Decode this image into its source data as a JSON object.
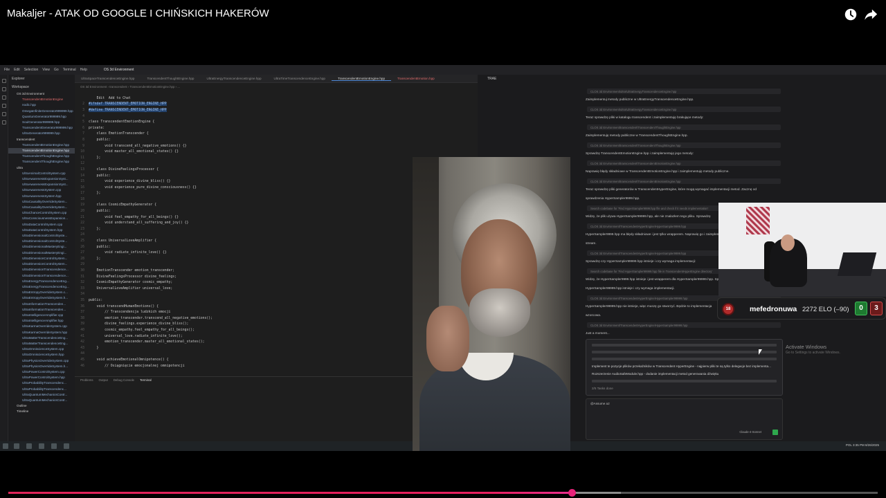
{
  "video": {
    "title": "Makaljer - ATAK OD GOOGLE I CHIŃSKICH HAKERÓW",
    "progress_played": 0.648,
    "progress_buffered": 0.705,
    "accent_color": "#e81f5e"
  },
  "icons": {
    "watch_later": "clock-icon",
    "share": "share-icon"
  },
  "ide": {
    "menu": [
      "File",
      "Edit",
      "Selection",
      "View",
      "Go",
      "Terminal",
      "Help"
    ],
    "workspace": "OS 3d Environment",
    "explorer_title": "Explorer",
    "workspace_label": "Workspace",
    "files": [
      {
        "name": "OS 3d Environment",
        "kind": "folder"
      },
      {
        "name": "TranscendentEmotionEngine",
        "kind": "red"
      },
      {
        "name": "nodic.hpp",
        "kind": "file"
      },
      {
        "name": "OmegaInfiniteGenerator999999.hpp",
        "kind": "file"
      },
      {
        "name": "QuantumGenerator999999.hpp",
        "kind": "file"
      },
      {
        "name": "SoulGenerator999999.hpp",
        "kind": "file"
      },
      {
        "name": "TranscendentGenerator999999.hpp",
        "kind": "file"
      },
      {
        "name": "UltraGenerator999999.hpp",
        "kind": "file"
      },
      {
        "name": "transcendent",
        "kind": "folder"
      },
      {
        "name": "TranscendentEmotionEngine.hpp",
        "kind": "file"
      },
      {
        "name": "TranscendentEmotionEngine.hpp",
        "kind": "sel"
      },
      {
        "name": "TranscendentThoughtEngine.hpp",
        "kind": "file"
      },
      {
        "name": "TranscendentThoughtEngine.hpp",
        "kind": "file"
      },
      {
        "name": "ultra",
        "kind": "folder"
      },
      {
        "name": "UltraAnimalControlSystem.cpp",
        "kind": "file"
      },
      {
        "name": "UltraAwarenessExpansionSyst...",
        "kind": "file"
      },
      {
        "name": "UltraAwarenessExpansionSyst...",
        "kind": "file"
      },
      {
        "name": "UltraAwarenessSystem.cpp",
        "kind": "file"
      },
      {
        "name": "UltraAwarenessSystem.hpp",
        "kind": "file"
      },
      {
        "name": "UltraCausalityOverrideSystem...",
        "kind": "file"
      },
      {
        "name": "UltraCausalityOverrideSystem...",
        "kind": "file"
      },
      {
        "name": "UltraChanceControlSystem.cpp",
        "kind": "file"
      },
      {
        "name": "UltraConsciousnessExpansion...",
        "kind": "file"
      },
      {
        "name": "UltraDataControlSystem.cpp",
        "kind": "file"
      },
      {
        "name": "UltraDataControlSystem.hpp",
        "kind": "file"
      },
      {
        "name": "UltraDimensionalControlSyste...",
        "kind": "file"
      },
      {
        "name": "UltraDimensionalControlSyste...",
        "kind": "file"
      },
      {
        "name": "UltraDimensionalMasteryEngi...",
        "kind": "file"
      },
      {
        "name": "UltraDimensionalMasteryEngi...",
        "kind": "file"
      },
      {
        "name": "UltraDimensionControlSystem...",
        "kind": "file"
      },
      {
        "name": "UltraDimensionControlSystem...",
        "kind": "file"
      },
      {
        "name": "UltraDimensionTranscendence...",
        "kind": "file"
      },
      {
        "name": "UltraDimensionTranscendence...",
        "kind": "file"
      },
      {
        "name": "UltraEnergyTranscendenceEng...",
        "kind": "file"
      },
      {
        "name": "UltraEnergyTranscendenceEng...",
        "kind": "file"
      },
      {
        "name": "UltraEntropyOverrideSystem.c...",
        "kind": "file"
      },
      {
        "name": "UltraEntropyOverrideSystem.h...",
        "kind": "file"
      },
      {
        "name": "UltraInformationTranscenden...",
        "kind": "file"
      },
      {
        "name": "UltraInformationTranscenden...",
        "kind": "file"
      },
      {
        "name": "UltraIntelligenceAmplifier.cpp",
        "kind": "file"
      },
      {
        "name": "UltraIntelligenceAmplifier.hpp",
        "kind": "file"
      },
      {
        "name": "UltraKarmaOverrideSystem.cpp",
        "kind": "file"
      },
      {
        "name": "UltraKarmaOverrideSystem.hpp",
        "kind": "file"
      },
      {
        "name": "UltraMatterTranscendenceEng...",
        "kind": "file"
      },
      {
        "name": "UltraMatterTranscendenceEng...",
        "kind": "file"
      },
      {
        "name": "UltraOmniscienceSystem.cpp",
        "kind": "file"
      },
      {
        "name": "UltraOmniscienceSystem.hpp",
        "kind": "file"
      },
      {
        "name": "UltraPhysicsOverrideSystem.cpp",
        "kind": "file"
      },
      {
        "name": "UltraPhysicsOverrideSystem.h...",
        "kind": "file"
      },
      {
        "name": "UltraPowerControlSystem.cpp",
        "kind": "file"
      },
      {
        "name": "UltraPowerControlSystem.hpp",
        "kind": "file"
      },
      {
        "name": "UltraProbabilityTranscendenc...",
        "kind": "file"
      },
      {
        "name": "UltraProbabilityTranscendenc...",
        "kind": "file"
      },
      {
        "name": "UltraQuantumMechanicsContr...",
        "kind": "file"
      },
      {
        "name": "UltraQuantumMechanicsContr...",
        "kind": "file"
      },
      {
        "name": "Outline",
        "kind": "folder"
      },
      {
        "name": "Timeline",
        "kind": "folder"
      }
    ],
    "tabs": [
      {
        "label": "UltraSpaceTranscendenceEngine.hpp",
        "state": ""
      },
      {
        "label": "TranscendentThoughtEngine.hpp",
        "state": ""
      },
      {
        "label": "UltraEnergyTranscendenceEngine.hpp",
        "state": ""
      },
      {
        "label": "UltraTimeTranscendenceEngine.hpp",
        "state": ""
      },
      {
        "label": "TranscendentEmotionEngine.hpp",
        "state": "active"
      },
      {
        "label": "TranscendentEmotion.hpp",
        "state": "mod"
      }
    ],
    "breadcrumb": "OS 3d Environment › transcendent › TranscendentEmotionEngine.hpp › ...",
    "code_lines": [
      {
        "n": "",
        "t": "    Edit  Add to Chat",
        "hl": false
      },
      {
        "n": "2",
        "t": "#ifndef TRANSCENDENT_EMOTION_ENGINE_HPP",
        "hl": true
      },
      {
        "n": "3",
        "t": "#define TRANSCENDENT_EMOTION_ENGINE_HPP",
        "hl": true
      },
      {
        "n": "4",
        "t": "",
        "hl": false
      },
      {
        "n": "5",
        "t": "class TranscendentEmotionEngine {",
        "hl": false
      },
      {
        "n": "6",
        "t": "private:",
        "hl": false
      },
      {
        "n": "7",
        "t": "    class EmotionTranscender {",
        "hl": false
      },
      {
        "n": "8",
        "t": "    public:",
        "hl": false
      },
      {
        "n": "9",
        "t": "        void transcend_all_negative_emotions() {}",
        "hl": false
      },
      {
        "n": "10",
        "t": "        void master_all_emotional_states() {}",
        "hl": false
      },
      {
        "n": "11",
        "t": "    };",
        "hl": false
      },
      {
        "n": "12",
        "t": "",
        "hl": false
      },
      {
        "n": "13",
        "t": "    class DivineFeelingsProcessor {",
        "hl": false
      },
      {
        "n": "14",
        "t": "    public:",
        "hl": false
      },
      {
        "n": "15",
        "t": "        void experience_divine_bliss() {}",
        "hl": false
      },
      {
        "n": "16",
        "t": "        void experience_pure_divine_consciousness() {}",
        "hl": false
      },
      {
        "n": "17",
        "t": "    };",
        "hl": false
      },
      {
        "n": "18",
        "t": "",
        "hl": false
      },
      {
        "n": "19",
        "t": "    class CosmicEmpathyGenerator {",
        "hl": false
      },
      {
        "n": "20",
        "t": "    public:",
        "hl": false
      },
      {
        "n": "21",
        "t": "        void feel_empathy_for_all_beings() {}",
        "hl": false
      },
      {
        "n": "22",
        "t": "        void understand_all_suffering_and_joy() {}",
        "hl": false
      },
      {
        "n": "23",
        "t": "    };",
        "hl": false
      },
      {
        "n": "24",
        "t": "",
        "hl": false
      },
      {
        "n": "25",
        "t": "    class UniversalLoveAmplifier {",
        "hl": false
      },
      {
        "n": "26",
        "t": "    public:",
        "hl": false
      },
      {
        "n": "27",
        "t": "        void radiate_infinite_love() {}",
        "hl": false
      },
      {
        "n": "28",
        "t": "    };",
        "hl": false
      },
      {
        "n": "29",
        "t": "",
        "hl": false
      },
      {
        "n": "30",
        "t": "    EmotionTranscender emotion_transcender;",
        "hl": false
      },
      {
        "n": "31",
        "t": "    DivineFeelingsProcessor divine_feelings;",
        "hl": false
      },
      {
        "n": "32",
        "t": "    CosmicEmpathyGenerator cosmic_empathy;",
        "hl": false
      },
      {
        "n": "33",
        "t": "    UniversalLoveAmplifier universal_love;",
        "hl": false
      },
      {
        "n": "34",
        "t": "",
        "hl": false
      },
      {
        "n": "35",
        "t": "public:",
        "hl": false
      },
      {
        "n": "36",
        "t": "    void transcendHumanEmotions() {",
        "hl": false
      },
      {
        "n": "37",
        "t": "        // Transcendencja ludzkich emocji",
        "hl": false
      },
      {
        "n": "38",
        "t": "        emotion_transcender.transcend_all_negative_emotions();",
        "hl": false
      },
      {
        "n": "39",
        "t": "        divine_feelings.experience_divine_bliss();",
        "hl": false
      },
      {
        "n": "40",
        "t": "        cosmic_empathy.feel_empathy_for_all_beings();",
        "hl": false
      },
      {
        "n": "41",
        "t": "        universal_love.radiate_infinite_love();",
        "hl": false
      },
      {
        "n": "42",
        "t": "        emotion_transcender.master_all_emotional_states();",
        "hl": false
      },
      {
        "n": "43",
        "t": "    }",
        "hl": false
      },
      {
        "n": "44",
        "t": "",
        "hl": false
      },
      {
        "n": "45",
        "t": "    void achieveEmotionalOmnipotence() {",
        "hl": false
      },
      {
        "n": "46",
        "t": "        // Osiągnięcie emocjonalnej omnipotencji",
        "hl": false
      }
    ],
    "panel_tabs": [
      "Problems",
      "Output",
      "Debug Console",
      "Terminal"
    ]
  },
  "chat": {
    "header": "TRAE",
    "messages": [
      {
        "kind": "tool",
        "text": "CLOS 3d Environment\\ultra\\UltraEnergyTranscendenceEngine.hpp"
      },
      {
        "kind": "msg",
        "text": "Zaimplementuj metody publiczne w UltraEnergyTranscendenceEngine.hpp."
      },
      {
        "kind": "tool",
        "text": "CLOS 3d Environment\\ultra\\UltraEnergyTranscendenceEngine.hpp"
      },
      {
        "kind": "msg",
        "text": "Teraz sprawdzę pliki w katalogu transcendent i zaimplementuję brakujące metody:"
      },
      {
        "kind": "tool",
        "text": "CLOS 3d Environment\\transcendent\\TranscendentThoughtEngine.hpp"
      },
      {
        "kind": "msg",
        "text": "Zaimplementuję metody publiczne w TranscendentThoughtEngine.hpp."
      },
      {
        "kind": "tool",
        "text": "CLOS 3d Environment\\transcendent\\TranscendentThoughtEngine.hpp"
      },
      {
        "kind": "msg",
        "text": "Sprawdzę TranscendentEmotionEngine.hpp i zaimplementuję jego metody:"
      },
      {
        "kind": "tool",
        "text": "CLOS 3d Environment\\transcendent\\TranscendentEmotionEngine.hpp"
      },
      {
        "kind": "msg",
        "text": "Naprawię błędy składniowe w TranscendentEmotionEngine.hpp i zaimplementuję metody publiczne."
      },
      {
        "kind": "tool",
        "text": "CLOS 3d Environment\\transcendent\\TranscendentEmotionEngine.hpp"
      },
      {
        "kind": "msg",
        "text": "Teraz sprawdzę pliki generatorów w TranscendentHyperEngine, które mogą wymagać implementacji metod. Zacznę od"
      },
      {
        "kind": "msg",
        "text": "sprawdzenia HyperSampler9999.hpp."
      },
      {
        "kind": "tool",
        "text": "Search codebase for 'Find HyperSampler9999.hpp file and check if it needs implementation'"
      },
      {
        "kind": "msg",
        "text": "Widzę, że plik używa HyperSampler99999.hpp, ale nie znalazłem tego pliku. Sprawdzę"
      },
      {
        "kind": "tool",
        "text": "CLOS 3d Environment\\TranscendentHyperEngine\\HyperSampler9999.hpp"
      },
      {
        "kind": "msg",
        "text": "HyperSampler9999.hpp ma błędy składniowe i jest tylko wrapperem. Naprawię go i zaimplementuję"
      },
      {
        "kind": "msg",
        "text": "stream."
      },
      {
        "kind": "tool",
        "text": "CLOS 3d Environment\\TranscendentHyperEngine\\HyperSampler9999.hpp"
      },
      {
        "kind": "msg",
        "text": "Sprawdzę czy HyperSampler99999.hpp istnieje i czy wymaga implementacji:"
      },
      {
        "kind": "tool",
        "text": "Search codebase for 'Find HyperSampler99999.hpp file in TranscendentHyperEngine directory'"
      },
      {
        "kind": "msg",
        "text": "Widzę, że HyperSampler9999.hpp istnieje i jest wrapperem dla HyperSampler99999.hpp. Sprawdzę czy"
      },
      {
        "kind": "msg",
        "text": "HyperSampler99999.hpp istnieje i czy wymaga implementacji."
      },
      {
        "kind": "tool",
        "text": "CLOS 3d Environment\\TranscendentHyperEngine\\HyperSampler99999.hpp"
      },
      {
        "kind": "msg",
        "text": "HyperSampler99999.hpp nie istnieje, więc muszę go stworzyć. Będzie to implementacja"
      },
      {
        "kind": "msg",
        "text": "wzorcowa."
      },
      {
        "kind": "tool",
        "text": "CLOS 3d Environment\\TranscendentHyperEngine\\HyperSampler99999.hpp"
      },
      {
        "kind": "msg",
        "text": "Just a moment..."
      }
    ],
    "todo_1": "Implement te pozycje plików przekaźników w Transcendent HyperEngine - najpierw pliki te są tylko delegacje bez implementa...",
    "todo_2": "Rozszerzenie AudioSafeModule.hpp - dodanie implementacji metod generowania dźwięku",
    "todo_count": "2/5 Tasks done",
    "compose_label": "@Assume a2",
    "model": "Claude-4-Sonnet"
  },
  "watermark": {
    "title": "Activate Windows",
    "subtitle": "Go to Settings to activate Windows."
  },
  "taskbar": {
    "tray": "POL 3:35 PM 8/26/2025"
  },
  "overlay": {
    "level_badge": "18",
    "player_name": "mefedronuwa",
    "elo_text": "2272 ELO (–90)",
    "wins": "0",
    "losses": "3"
  }
}
